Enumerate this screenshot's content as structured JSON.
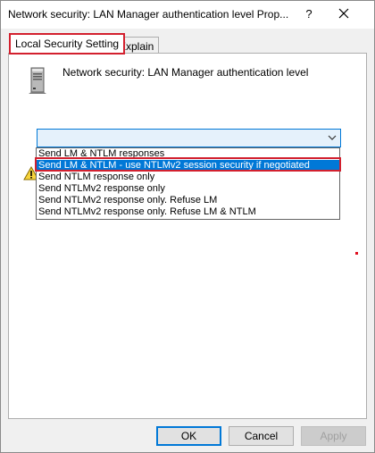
{
  "window": {
    "title": "Network security: LAN Manager authentication level Prop...",
    "help_label": "?"
  },
  "tabs": [
    {
      "label": "Local Security Setting",
      "active": true
    },
    {
      "label": "Explain",
      "active": false
    }
  ],
  "policy": {
    "name": "Network security: LAN Manager authentication level",
    "icon": "server-icon"
  },
  "combo": {
    "value": "",
    "icon": "chevron-down-icon"
  },
  "dropdown": {
    "options": [
      "Send LM & NTLM responses",
      "Send LM & NTLM - use NTLMv2 session security if negotiated",
      "Send NTLM response only",
      "Send NTLMv2 response only",
      "Send NTLMv2 response only. Refuse LM",
      "Send NTLMv2 response only. Refuse LM & NTLM"
    ],
    "selected_index": 1
  },
  "buttons": {
    "ok": "OK",
    "cancel": "Cancel",
    "apply": "Apply"
  },
  "colors": {
    "highlight": "#0078d7",
    "annotation_red": "#d3202e",
    "panel": "#ffffff",
    "window_bg": "#f0f0f0"
  }
}
